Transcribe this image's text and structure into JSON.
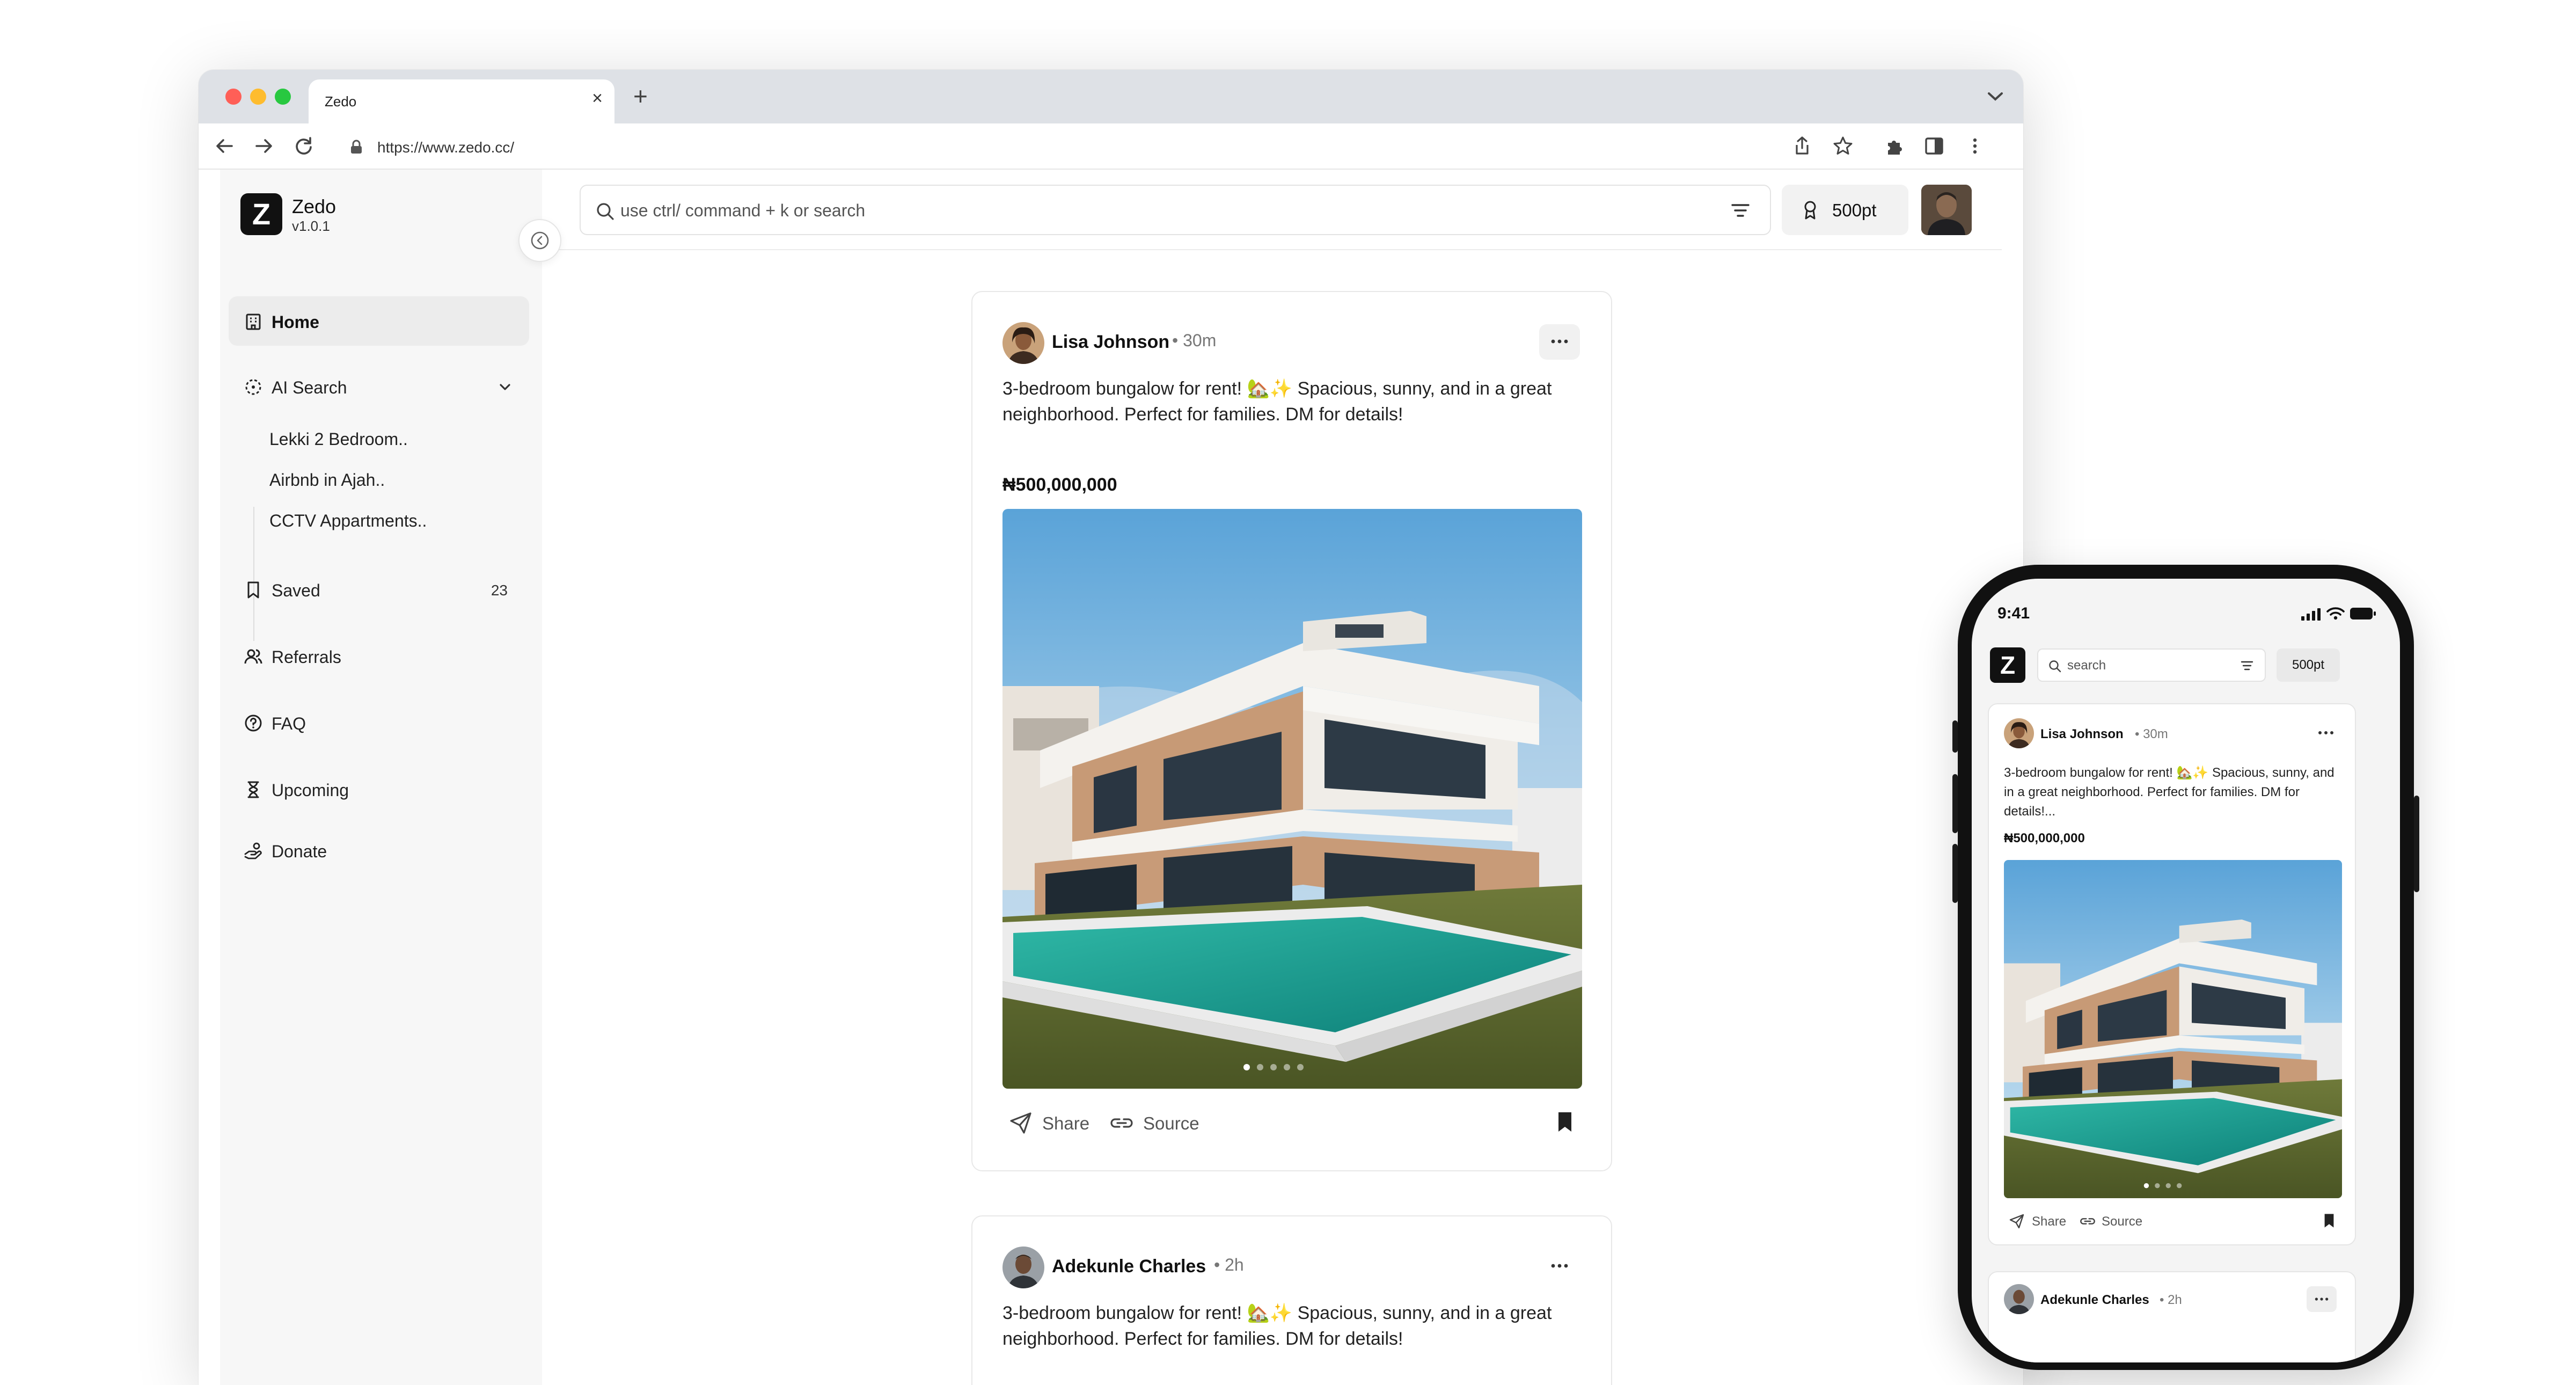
{
  "browser": {
    "tab_title": "Zedo",
    "url": "https://www.zedo.cc/"
  },
  "brand": {
    "logo_letter": "Z",
    "name": "Zedo",
    "version": "v1.0.1"
  },
  "sidebar": {
    "home": "Home",
    "ai_search": "AI Search",
    "ai_search_items": [
      "Lekki 2 Bedroom..",
      "Airbnb in Ajah..",
      "CCTV Appartments.."
    ],
    "saved": "Saved",
    "saved_count": "23",
    "referrals": "Referrals",
    "faq": "FAQ",
    "upcoming": "Upcoming",
    "donate": "Donate"
  },
  "header": {
    "search_placeholder": "use ctrl/ command + k or search",
    "points": "500pt"
  },
  "posts": [
    {
      "user": "Lisa Johnson",
      "time": "• 30m",
      "text": "3-bedroom bungalow for rent! 🏡✨ Spacious, sunny, and in a great neighborhood. Perfect for families. DM for details!",
      "price": "₦500,000,000",
      "share": "Share",
      "source": "Source"
    },
    {
      "user": "Adekunle Charles",
      "time": "• 2h",
      "text": "3-bedroom bungalow for rent! 🏡✨ Spacious, sunny, and in a great neighborhood. Perfect for families. DM for details!"
    }
  ],
  "phone": {
    "time": "9:41",
    "logo_letter": "Z",
    "search_placeholder": "search",
    "points": "500pt",
    "post": {
      "user": "Lisa Johnson",
      "time": "• 30m",
      "text": "3-bedroom bungalow for rent! 🏡✨ Spacious, sunny, and in a great neighborhood. Perfect for families. DM for details!...",
      "price": "₦500,000,000",
      "share": "Share",
      "source": "Source"
    },
    "post2": {
      "user": "Adekunle Charles",
      "time": "• 2h"
    }
  },
  "colors": {
    "accent": "#111111",
    "pool": "#1aa597",
    "sky": "#6fb0dc"
  }
}
